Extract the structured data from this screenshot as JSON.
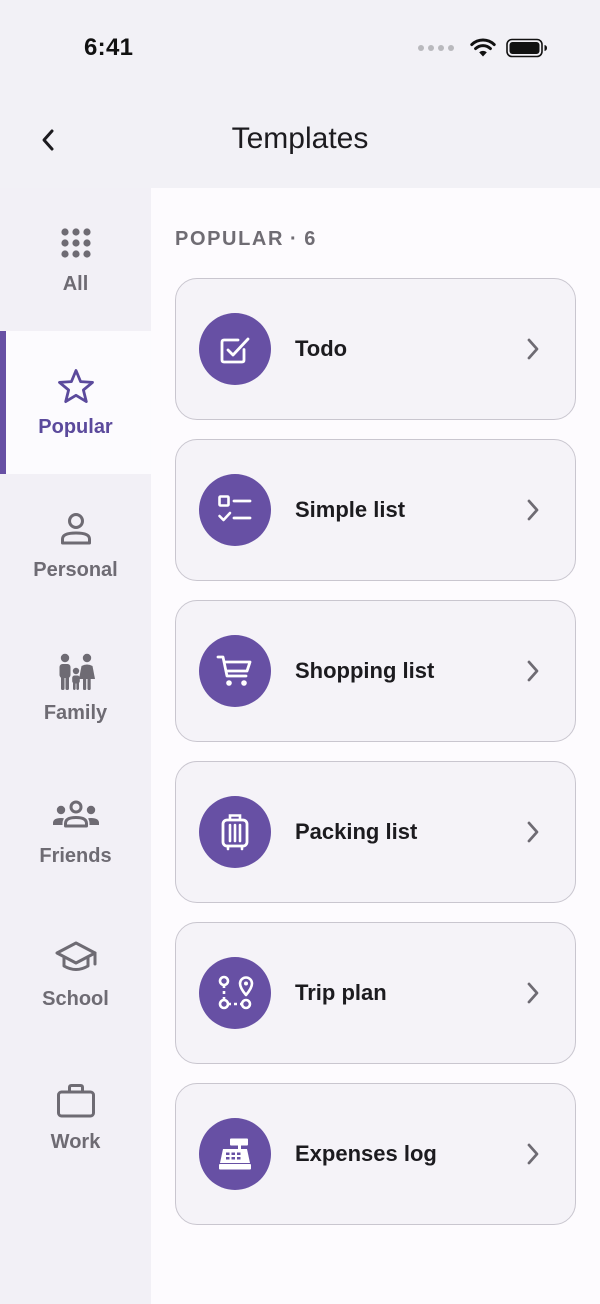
{
  "status_bar": {
    "time": "6:41"
  },
  "header": {
    "title": "Templates"
  },
  "sidebar": {
    "items": [
      {
        "label": "All",
        "icon": "grid-icon"
      },
      {
        "label": "Popular",
        "icon": "star-icon",
        "active": true
      },
      {
        "label": "Personal",
        "icon": "person-icon"
      },
      {
        "label": "Family",
        "icon": "family-icon"
      },
      {
        "label": "Friends",
        "icon": "friends-icon"
      },
      {
        "label": "School",
        "icon": "school-icon"
      },
      {
        "label": "Work",
        "icon": "briefcase-icon"
      }
    ]
  },
  "main": {
    "section": {
      "name": "POPULAR",
      "separator": "·",
      "count": "6"
    },
    "templates": [
      {
        "label": "Todo",
        "icon": "checkbox-icon"
      },
      {
        "label": "Simple list",
        "icon": "checklist-icon"
      },
      {
        "label": "Shopping list",
        "icon": "cart-icon"
      },
      {
        "label": "Packing list",
        "icon": "luggage-icon"
      },
      {
        "label": "Trip plan",
        "icon": "route-icon"
      },
      {
        "label": "Expenses log",
        "icon": "register-icon"
      }
    ]
  },
  "colors": {
    "accent": "#6750a4",
    "active_label": "#5b4a9c",
    "sidebar_bg": "#f2f0f6",
    "card_bg": "#f5f3f8",
    "card_border": "#c9c6cf"
  }
}
